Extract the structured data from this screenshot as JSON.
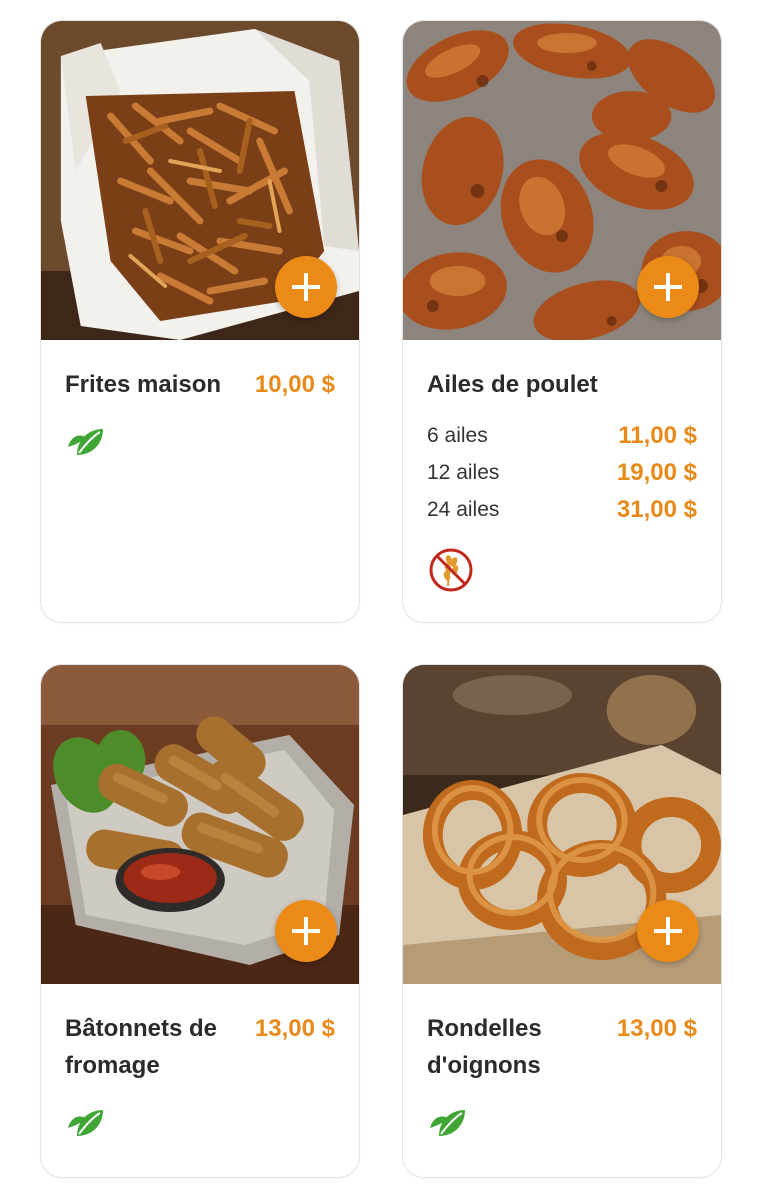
{
  "colors": {
    "accent": "#ec8a17",
    "price": "#e88a1a",
    "text": "#2b2b2b",
    "vegan_green": "#3fa535",
    "gluten_free_red": "#c0281e"
  },
  "menu_items": [
    {
      "image": "fries-in-box",
      "name": "Frites maison",
      "price": "10,00 $",
      "diet_icon": "vegan-leaf-icon",
      "add_icon": "plus-icon"
    },
    {
      "image": "chicken-wings",
      "name": "Ailes de poulet",
      "variants": [
        {
          "label": "6 ailes",
          "price": "11,00 $"
        },
        {
          "label": "12 ailes",
          "price": "19,00 $"
        },
        {
          "label": "24 ailes",
          "price": "31,00 $"
        }
      ],
      "diet_icon": "gluten-free-icon",
      "add_icon": "plus-icon"
    },
    {
      "image": "mozzarella-sticks",
      "name": "Bâtonnets de fromage",
      "price": "13,00 $",
      "diet_icon": "vegan-leaf-icon",
      "add_icon": "plus-icon"
    },
    {
      "image": "onion-rings",
      "name": "Rondelles d'oignons",
      "price": "13,00 $",
      "diet_icon": "vegan-leaf-icon",
      "add_icon": "plus-icon"
    }
  ]
}
